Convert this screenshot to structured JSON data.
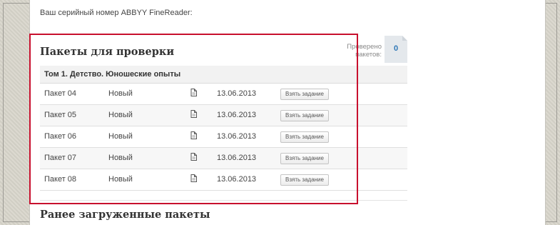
{
  "serial_text": "Ваш серийный номер ABBYY FineReader:",
  "packages_section": {
    "title": "Пакеты для проверки",
    "checked_label_line1": "Проверено",
    "checked_label_line2": "пакетов:",
    "checked_count": "0",
    "volume_title": "Том 1. Детство. Юношеские опыты",
    "rows": [
      {
        "name": "Пакет 04",
        "status": "Новый",
        "date": "13.06.2013",
        "button": "Взять задание"
      },
      {
        "name": "Пакет 05",
        "status": "Новый",
        "date": "13.06.2013",
        "button": "Взять задание"
      },
      {
        "name": "Пакет 06",
        "status": "Новый",
        "date": "13.06.2013",
        "button": "Взять задание"
      },
      {
        "name": "Пакет 07",
        "status": "Новый",
        "date": "13.06.2013",
        "button": "Взять задание"
      },
      {
        "name": "Пакет 08",
        "status": "Новый",
        "date": "13.06.2013",
        "button": "Взять задание"
      }
    ]
  },
  "previous_section": {
    "title": "Ранее загруженные пакеты"
  },
  "colors": {
    "highlight_border": "#c8102e",
    "counter_value": "#2f78b7",
    "counter_background": "#e4e8ec"
  },
  "icons": {
    "document": "document-icon"
  }
}
